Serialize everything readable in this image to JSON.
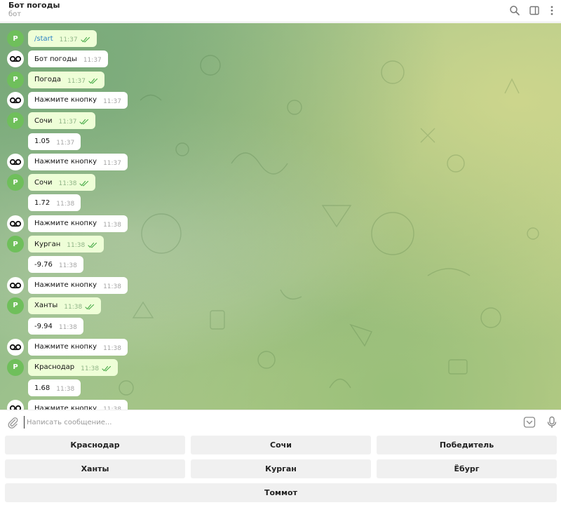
{
  "header": {
    "title": "Бот погоды",
    "subtitle": "бот",
    "icons": [
      "search-icon",
      "sidebar-toggle-icon",
      "more-vertical-icon"
    ]
  },
  "avatars": {
    "user_initial": "Р",
    "user_color": "#6fbf5b",
    "bot_icon": "bot-avatar-icon"
  },
  "messages": [
    {
      "side": "out",
      "text": "/start",
      "time": "11:37",
      "read": true
    },
    {
      "side": "in",
      "text": "Бот погоды",
      "time": "11:37"
    },
    {
      "side": "out",
      "text": "Погода",
      "time": "11:37",
      "read": true
    },
    {
      "side": "in",
      "text": "Нажмите кнопку",
      "time": "11:37"
    },
    {
      "side": "out",
      "text": "Сочи",
      "time": "11:37",
      "read": true
    },
    {
      "side": "in",
      "text": "1.05",
      "time": "11:37"
    },
    {
      "side": "in",
      "text": "Нажмите кнопку",
      "time": "11:37"
    },
    {
      "side": "out",
      "text": "Сочи",
      "time": "11:38",
      "read": true
    },
    {
      "side": "in",
      "text": "1.72",
      "time": "11:38"
    },
    {
      "side": "in",
      "text": "Нажмите кнопку",
      "time": "11:38"
    },
    {
      "side": "out",
      "text": "Курган",
      "time": "11:38",
      "read": true
    },
    {
      "side": "in",
      "text": "-9.76",
      "time": "11:38"
    },
    {
      "side": "in",
      "text": "Нажмите кнопку",
      "time": "11:38"
    },
    {
      "side": "out",
      "text": "Ханты",
      "time": "11:38",
      "read": true
    },
    {
      "side": "in",
      "text": "-9.94",
      "time": "11:38"
    },
    {
      "side": "in",
      "text": "Нажмите кнопку",
      "time": "11:38"
    },
    {
      "side": "out",
      "text": "Краснодар",
      "time": "11:38",
      "read": true
    },
    {
      "side": "in",
      "text": "1.68",
      "time": "11:38"
    },
    {
      "side": "in",
      "text": "Нажмите кнопку",
      "time": "11:38"
    }
  ],
  "input": {
    "placeholder": "Написать сообщение...",
    "value": ""
  },
  "keyboard": {
    "rows": [
      [
        "Краснодар",
        "Сочи",
        "Победитель"
      ],
      [
        "Ханты",
        "Курган",
        "Ёбург"
      ],
      [
        "Томмот"
      ]
    ]
  },
  "colors": {
    "out_bubble": "#eefed7",
    "in_bubble": "#ffffff",
    "accent": "#4fae4e",
    "command_link": "#2a82c5"
  }
}
